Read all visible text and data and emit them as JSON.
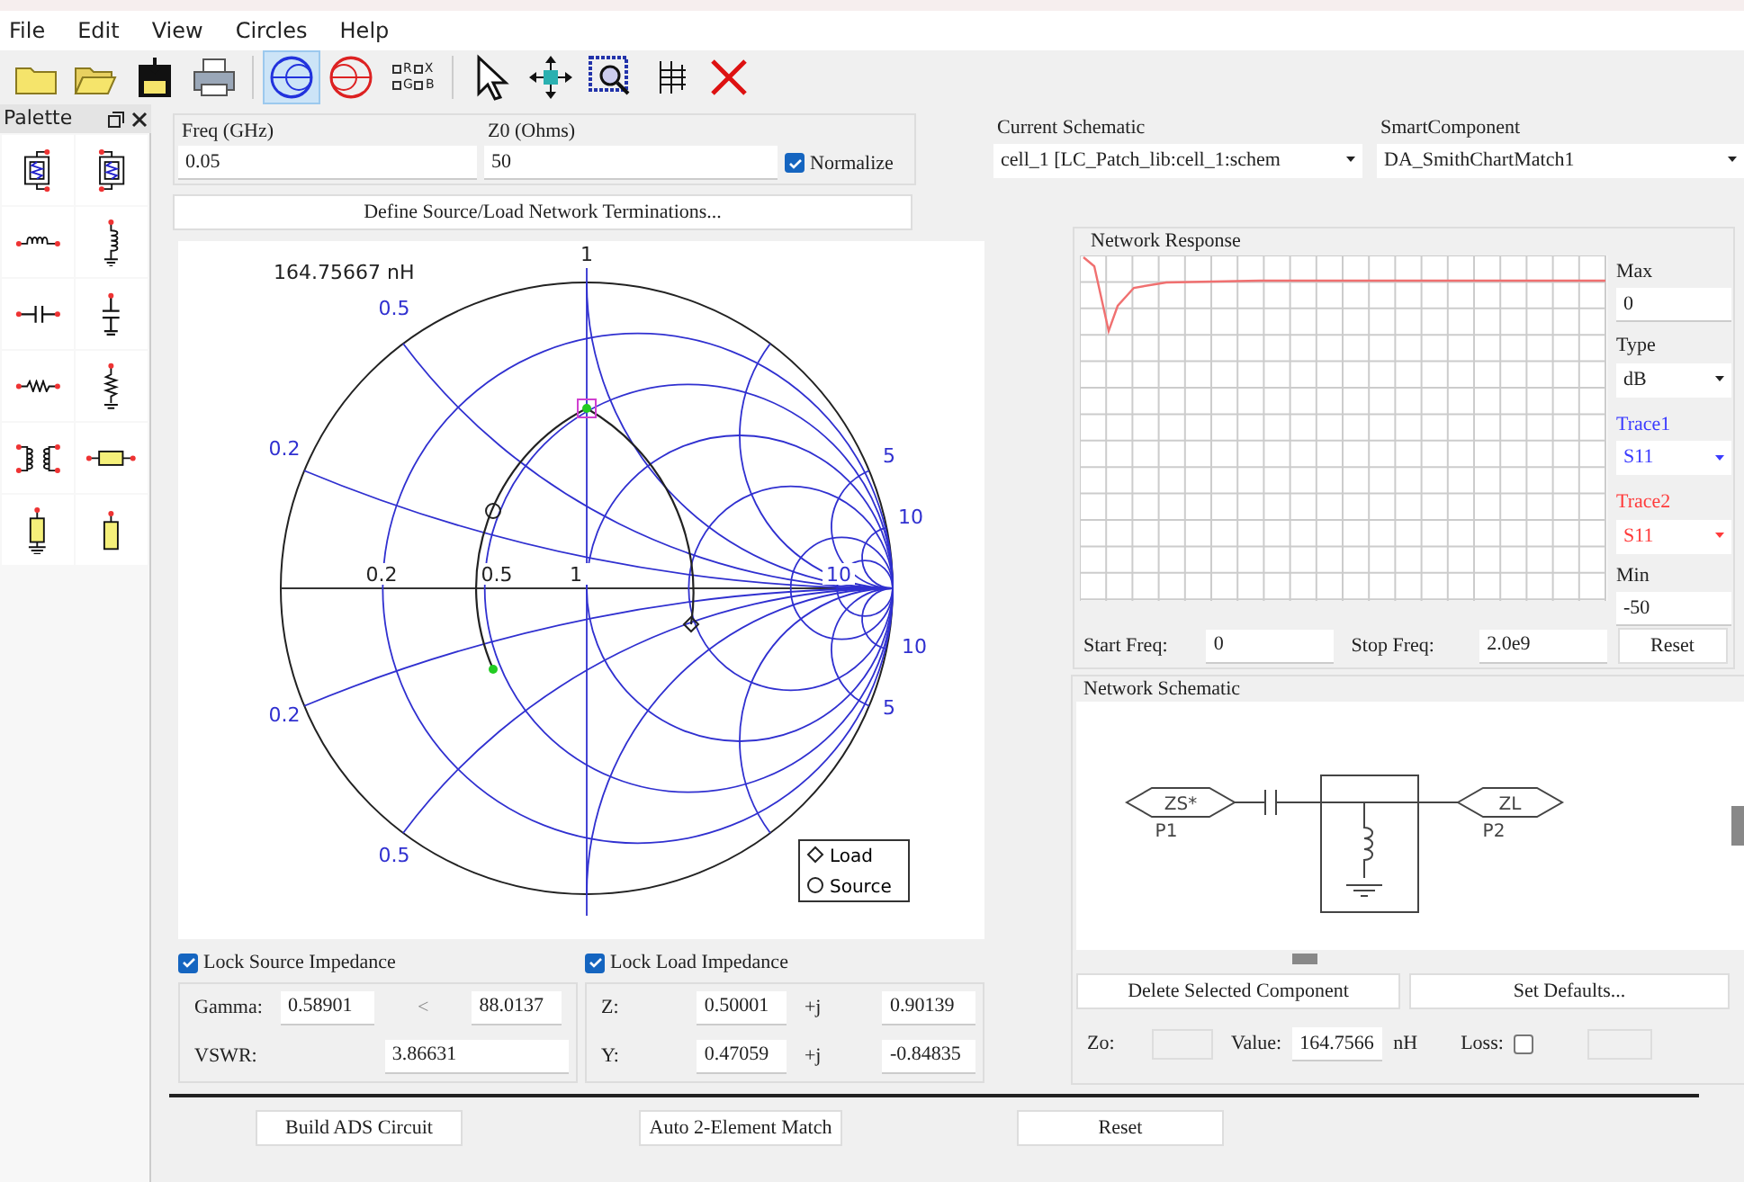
{
  "menu": [
    "File",
    "Edit",
    "View",
    "Circles",
    "Help"
  ],
  "toolbar": [
    {
      "kind": "folder",
      "selected": false
    },
    {
      "kind": "open",
      "selected": false
    },
    {
      "kind": "save",
      "selected": false
    },
    {
      "kind": "print",
      "selected": false
    },
    {
      "kind": "smith-z",
      "selected": true
    },
    {
      "kind": "smith-y",
      "selected": false
    },
    {
      "kind": "rx-gb",
      "selected": false,
      "labels": [
        "R",
        "X",
        "G",
        "B"
      ]
    },
    {
      "kind": "pointer",
      "selected": false
    },
    {
      "kind": "move",
      "selected": false
    },
    {
      "kind": "zoom",
      "selected": false
    },
    {
      "kind": "grid",
      "selected": false
    },
    {
      "kind": "delete",
      "selected": false
    }
  ],
  "palette": {
    "title": "Palette",
    "items": [
      {
        "kind": "z-series"
      },
      {
        "kind": "z-shunt"
      },
      {
        "kind": "l-series"
      },
      {
        "kind": "l-shunt"
      },
      {
        "kind": "c-series"
      },
      {
        "kind": "c-shunt"
      },
      {
        "kind": "r-series"
      },
      {
        "kind": "r-shunt"
      },
      {
        "kind": "transformer"
      },
      {
        "kind": "tline-series"
      },
      {
        "kind": "tline-shunt-short"
      },
      {
        "kind": "tline-shunt-open"
      }
    ]
  },
  "freq": {
    "label": "Freq (GHz)",
    "value": "0.05"
  },
  "z0": {
    "label": "Z0 (Ohms)",
    "value": "50"
  },
  "normalize": {
    "label": "Normalize",
    "checked": true
  },
  "current_schematic": {
    "label": "Current Schematic",
    "value": "cell_1 [LC_Patch_lib:cell_1:schem"
  },
  "smart_component": {
    "label": "SmartComponent",
    "value": "DA_SmithChartMatch1"
  },
  "define_button": "Define Source/Load Network Terminations...",
  "smith": {
    "value_label": "164.75667 nH",
    "labels": [
      "1",
      "0.5",
      "0.2",
      "5",
      "10",
      "0.2",
      "0.5",
      "1",
      "10",
      "10",
      "5",
      "0.2",
      "0.5"
    ],
    "legend": [
      "Load",
      "Source"
    ]
  },
  "network_response": {
    "title": "Network Response",
    "max": {
      "label": "Max",
      "value": "0"
    },
    "type": {
      "label": "Type",
      "value": "dB"
    },
    "trace1": {
      "label": "Trace1",
      "value": "S11",
      "color": "#3b3bff"
    },
    "trace2": {
      "label": "Trace2",
      "value": "S11",
      "color": "#ff3b3b"
    },
    "min": {
      "label": "Min",
      "value": "-50"
    },
    "start": {
      "label": "Start Freq:",
      "value": "0"
    },
    "stop": {
      "label": "Stop Freq:",
      "value": "2.0e9"
    },
    "reset": "Reset"
  },
  "network_schematic": {
    "title": "Network Schematic",
    "source_port": "ZS*",
    "source_name": "P1",
    "load_port": "ZL",
    "load_name": "P2",
    "delete_button": "Delete Selected Component",
    "defaults_button": "Set Defaults...",
    "zo_label": "Zo:",
    "value_label": "Value:",
    "value": "164.7566",
    "unit": "nH",
    "loss_label": "Loss:",
    "loss_checked": false
  },
  "lock_source": {
    "label": "Lock Source Impedance",
    "checked": true
  },
  "lock_load": {
    "label": "Lock Load Impedance",
    "checked": true
  },
  "gamma": {
    "label": "Gamma:",
    "magnitude": "0.58901",
    "angle_sign": "<",
    "angle": "88.0137"
  },
  "vswr": {
    "label": "VSWR:",
    "value": "3.86631"
  },
  "z": {
    "label": "Z:",
    "real": "0.50001",
    "j": "+j",
    "imag": "0.90139"
  },
  "y": {
    "label": "Y:",
    "real": "0.47059",
    "j": "+j",
    "imag": "-0.84835"
  },
  "bottom_buttons": [
    "Build ADS Circuit",
    "Auto 2-Element Match",
    "Reset"
  ]
}
